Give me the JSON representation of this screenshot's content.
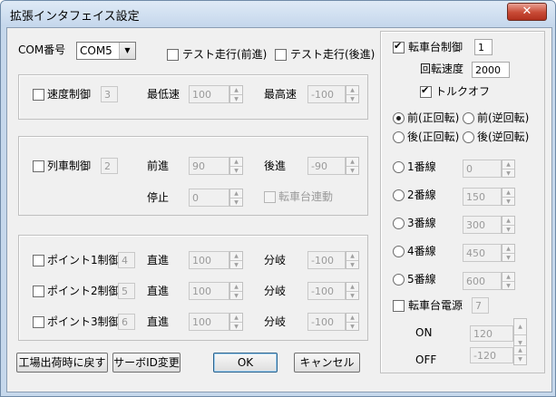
{
  "window": {
    "title": "拡張インタフェイス設定",
    "close_glyph": "✕"
  },
  "com": {
    "label": "COM番号",
    "value": "COM5",
    "dropdown_glyph": "▼"
  },
  "test_run": {
    "forward_label": "テスト走行(前進)",
    "backward_label": "テスト走行(後進)"
  },
  "speed": {
    "label": "速度制御",
    "id": "3",
    "min_label": "最低速",
    "min_value": "100",
    "max_label": "最高速",
    "max_value": "-100"
  },
  "train": {
    "label": "列車制御",
    "id": "2",
    "fwd_label": "前進",
    "fwd_value": "90",
    "back_label": "後進",
    "back_value": "-90",
    "stop_label": "停止",
    "stop_value": "0",
    "turntable_link_label": "転車台連動"
  },
  "points": [
    {
      "label": "ポイント1制御",
      "id": "4",
      "straight_label": "直進",
      "straight_value": "100",
      "branch_label": "分岐",
      "branch_value": "-100"
    },
    {
      "label": "ポイント2制御",
      "id": "5",
      "straight_label": "直進",
      "straight_value": "100",
      "branch_label": "分岐",
      "branch_value": "-100"
    },
    {
      "label": "ポイント3制御",
      "id": "6",
      "straight_label": "直進",
      "straight_value": "100",
      "branch_label": "分岐",
      "branch_value": "-100"
    }
  ],
  "turntable": {
    "label": "転車台制御",
    "id": "1",
    "checked": true,
    "speed_label": "回転速度",
    "speed_value": "2000",
    "torque_off_label": "トルクオフ",
    "torque_off_checked": true,
    "directions": [
      {
        "label": "前(正回転)",
        "checked": true
      },
      {
        "label": "前(逆回転)",
        "checked": false
      },
      {
        "label": "後(正回転)",
        "checked": false
      },
      {
        "label": "後(逆回転)",
        "checked": false
      }
    ],
    "tracks": [
      {
        "label": "1番線",
        "value": "0"
      },
      {
        "label": "2番線",
        "value": "150"
      },
      {
        "label": "3番線",
        "value": "300"
      },
      {
        "label": "4番線",
        "value": "450"
      },
      {
        "label": "5番線",
        "value": "600"
      }
    ],
    "power": {
      "label": "転車台電源",
      "id": "7",
      "on_label": "ON",
      "on_value": "120",
      "off_label": "OFF",
      "off_value": "-120"
    }
  },
  "buttons": {
    "factory_reset": "工場出荷時に戻す",
    "servo_id": "サーボID変更",
    "ok": "OK",
    "cancel": "キャンセル"
  },
  "icons": {
    "spin_up": "▲",
    "spin_down": "▼"
  }
}
